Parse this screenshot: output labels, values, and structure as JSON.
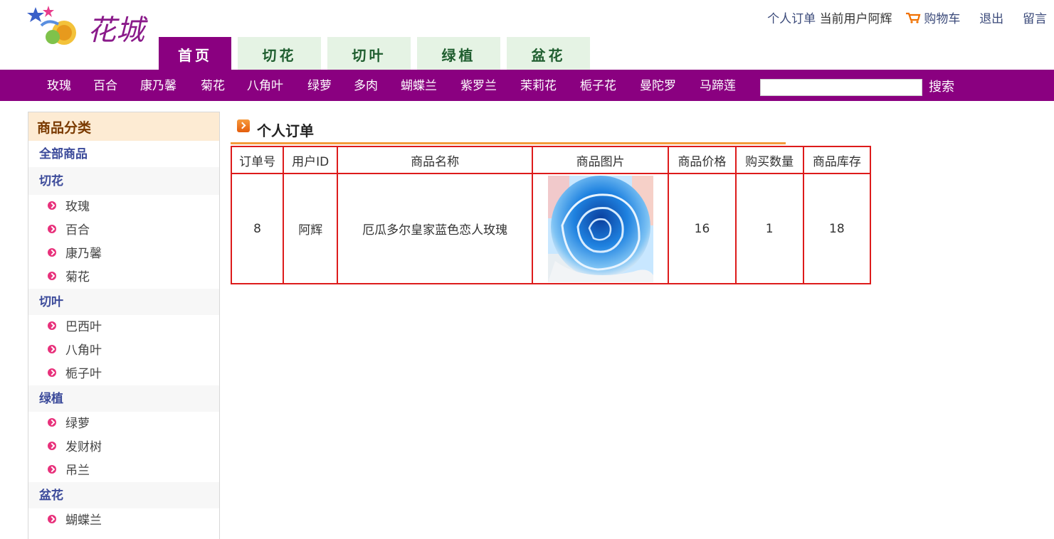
{
  "header": {
    "logo_text": "花城",
    "links": {
      "orders": "个人订单",
      "current_user": "当前用户阿辉",
      "cart": "购物车",
      "logout": "退出",
      "message": "留言"
    }
  },
  "tabs": [
    {
      "label": "首页",
      "active": true
    },
    {
      "label": "切花",
      "active": false
    },
    {
      "label": "切叶",
      "active": false
    },
    {
      "label": "绿植",
      "active": false
    },
    {
      "label": "盆花",
      "active": false
    }
  ],
  "nav_categories": [
    "玫瑰",
    "百合",
    "康乃馨",
    "菊花",
    "八角叶",
    "绿萝",
    "多肉",
    "蝴蝶兰",
    "紫罗兰",
    "茉莉花",
    "栀子花",
    "曼陀罗",
    "马蹄莲"
  ],
  "search": {
    "value": "",
    "button": "搜索"
  },
  "sidebar": {
    "title": "商品分类",
    "all": "全部商品",
    "groups": [
      {
        "name": "切花",
        "items": [
          "玫瑰",
          "百合",
          "康乃馨",
          "菊花"
        ]
      },
      {
        "name": "切叶",
        "items": [
          "巴西叶",
          "八角叶",
          "栀子叶"
        ]
      },
      {
        "name": "绿植",
        "items": [
          "绿萝",
          "发财树",
          "吊兰"
        ]
      },
      {
        "name": "盆花",
        "items": [
          "蝴蝶兰"
        ]
      }
    ]
  },
  "main": {
    "title": "个人订单",
    "columns": [
      "订单号",
      "用户ID",
      "商品名称",
      "商品图片",
      "商品价格",
      "购买数量",
      "商品库存"
    ],
    "rows": [
      {
        "order_id": "8",
        "user_id": "阿辉",
        "name": "厄瓜多尔皇家蓝色恋人玫瑰",
        "price": "16",
        "qty": "1",
        "stock": "18"
      }
    ]
  },
  "colors": {
    "nav_purple": "#8a0080",
    "tab_green_bg": "#e5f3e4",
    "table_border": "#dd1b1b",
    "accent_orange": "#f49a3a"
  }
}
